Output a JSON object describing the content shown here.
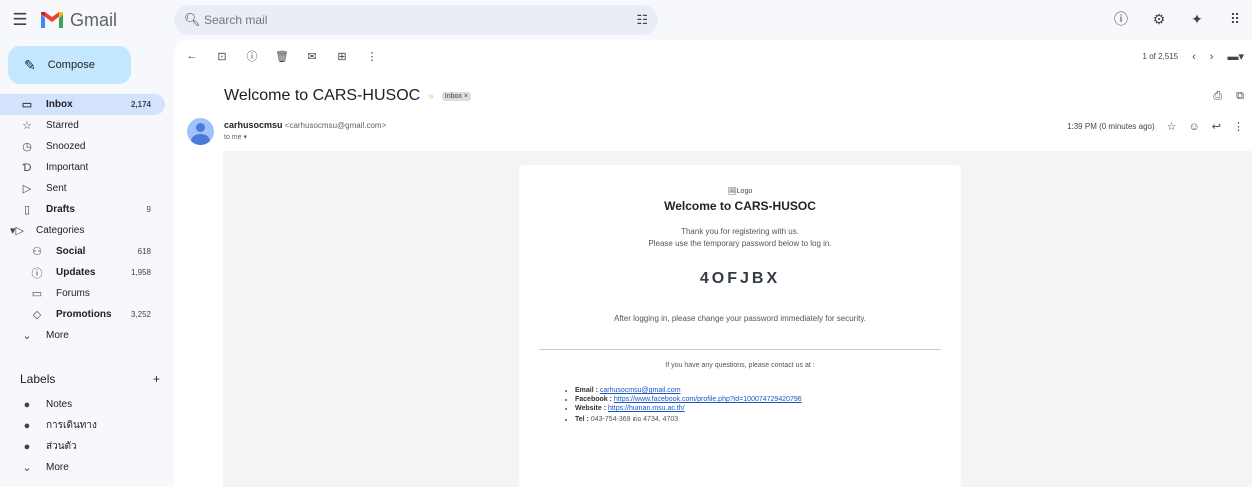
{
  "app": {
    "name": "Gmail"
  },
  "search": {
    "placeholder": "Search mail"
  },
  "compose": {
    "label": "Compose"
  },
  "nav": [
    {
      "label": "Inbox",
      "count": "2,174",
      "icon": "inbox-icon",
      "glyph": "▭",
      "active": true
    },
    {
      "label": "Starred",
      "count": "",
      "icon": "star-icon",
      "glyph": "☆"
    },
    {
      "label": "Snoozed",
      "count": "",
      "icon": "clock-icon",
      "glyph": "◷"
    },
    {
      "label": "Important",
      "count": "",
      "icon": "important-icon",
      "glyph": "Ɗ"
    },
    {
      "label": "Sent",
      "count": "",
      "icon": "send-icon",
      "glyph": "▷"
    },
    {
      "label": "Drafts",
      "count": "9",
      "icon": "draft-icon",
      "glyph": "▯",
      "bold": true
    },
    {
      "label": "Categories",
      "count": "",
      "icon": "label-outline-icon",
      "glyph": "▾▷",
      "cat": true
    },
    {
      "label": "Social",
      "count": "618",
      "icon": "people-icon",
      "glyph": "⚇",
      "bold": true,
      "sub": true
    },
    {
      "label": "Updates",
      "count": "1,958",
      "icon": "info-icon",
      "glyph": "ⓘ",
      "bold": true,
      "sub": true
    },
    {
      "label": "Forums",
      "count": "",
      "icon": "forum-icon",
      "glyph": "▭",
      "sub": true
    },
    {
      "label": "Promotions",
      "count": "3,252",
      "icon": "tag-icon",
      "glyph": "◇",
      "bold": true,
      "sub": true
    },
    {
      "label": "More",
      "count": "",
      "icon": "chevron-down-icon",
      "glyph": "⌄"
    }
  ],
  "labels": {
    "heading": "Labels",
    "items": [
      {
        "label": "Notes",
        "icon": "label-icon"
      },
      {
        "label": "การเดินทาง",
        "icon": "label-icon"
      },
      {
        "label": "ส่วนตัว",
        "icon": "label-icon"
      },
      {
        "label": "More",
        "icon": "chevron-down-icon"
      }
    ]
  },
  "pager": {
    "text": "1 of 2,515"
  },
  "message": {
    "subject": "Welcome to CARS-HUSOC",
    "label_badge": "Inbox ×",
    "sender_name": "carhusocmsu",
    "sender_email": "<carhusocmsu@gmail.com>",
    "to": "to me ▾",
    "time": "1:39 PM (0 minutes ago)"
  },
  "email": {
    "logo_alt": "Logo",
    "heading": "Welcome to CARS-HUSOC",
    "line1": "Thank you for registering with us.",
    "line2": "Please use the temporary password below to log in.",
    "password": "4OFJBX",
    "line3": "After logging in, please change your password immediately for security.",
    "contact_intro": "If you have any questions, please contact us at :",
    "contacts": [
      {
        "label": "Email :",
        "value": "carhusocmsu@gmail.com",
        "link": true
      },
      {
        "label": "Facebook :",
        "value": "https://www.facebook.com/profile.php?id=100074729420796",
        "link": true
      },
      {
        "label": "Website :",
        "value": "https://human.msu.ac.th/",
        "link": true
      },
      {
        "label": "Tel :",
        "value": "043-754-369 ต่อ 4734, 4703",
        "link": false
      }
    ]
  }
}
